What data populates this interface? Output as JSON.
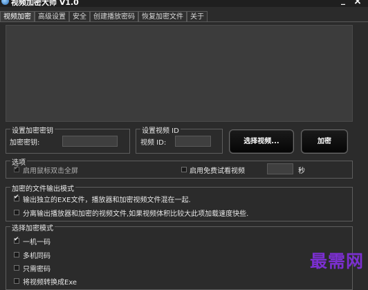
{
  "window": {
    "title": "视频加密大师 V1.0",
    "minimize": "_",
    "close": "×"
  },
  "tabs": [
    {
      "label": "视频加密",
      "active": true
    },
    {
      "label": "高级设置",
      "active": false
    },
    {
      "label": "安全",
      "active": false
    },
    {
      "label": "创建播放密码",
      "active": false
    },
    {
      "label": "恢复加密文件",
      "active": false
    },
    {
      "label": "关于",
      "active": false
    }
  ],
  "password_group": {
    "title": "设置加密密钥",
    "label": "加密密钥:",
    "value": ""
  },
  "video_id_group": {
    "title": "设置视频 ID",
    "label": "视频 ID:",
    "value": ""
  },
  "buttons": {
    "select_video": "选择视频...",
    "encrypt": "加密"
  },
  "options": {
    "title": "选项",
    "fullscreen": {
      "label": "启用鼠标双击全屏",
      "checked": true,
      "disabled": true
    },
    "trial": {
      "label": "启用免费试看视频",
      "checked": false
    },
    "trial_value": "",
    "seconds_unit": "秒"
  },
  "output_mode": {
    "title": "加密的文件输出模式",
    "items": [
      {
        "label": "输出独立的EXE文件，播放器和加密视频文件混在一起.",
        "checked": true
      },
      {
        "label": "分离输出播放器和加密的视频文件,如果视频体积比较大此项加载速度快些.",
        "checked": false
      }
    ]
  },
  "encrypt_mode": {
    "title": "选择加密模式",
    "items": [
      {
        "label": "一机一码",
        "checked": true
      },
      {
        "label": "多机同码",
        "checked": false
      },
      {
        "label": "只需密码",
        "checked": false
      },
      {
        "label": "将视频转换成Exe",
        "checked": false
      }
    ]
  },
  "watermark": "最需网",
  "colors": {
    "background": "#2b2b2b",
    "watermark": "#7b2fd0"
  }
}
